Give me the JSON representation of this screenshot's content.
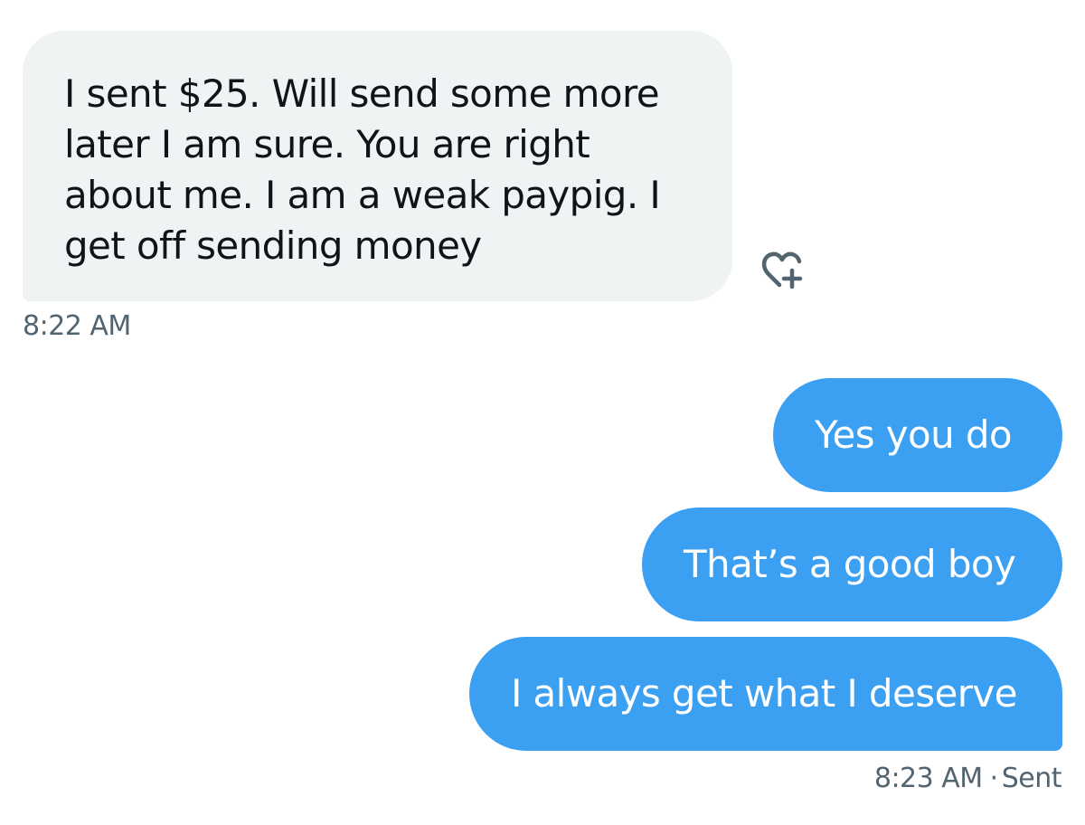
{
  "conversation": {
    "incoming_message": {
      "text": "I sent $25. Will send some more\nlater I am sure.  You are right\nabout me.  I am a weak paypig.  I\nget off sending money",
      "time": "8:22 AM",
      "reaction_icon": "heart-plus-icon"
    },
    "outgoing_messages": [
      {
        "text": "Yes you do"
      },
      {
        "text": "That’s a good boy"
      },
      {
        "text": "I always get what I deserve"
      }
    ],
    "outgoing_time": "8:23 AM",
    "outgoing_separator": "·",
    "outgoing_status": "Sent"
  },
  "colors": {
    "incoming_bubble": "#eff3f4",
    "outgoing_bubble": "#3b9ff2",
    "timestamp_text": "#536471"
  }
}
